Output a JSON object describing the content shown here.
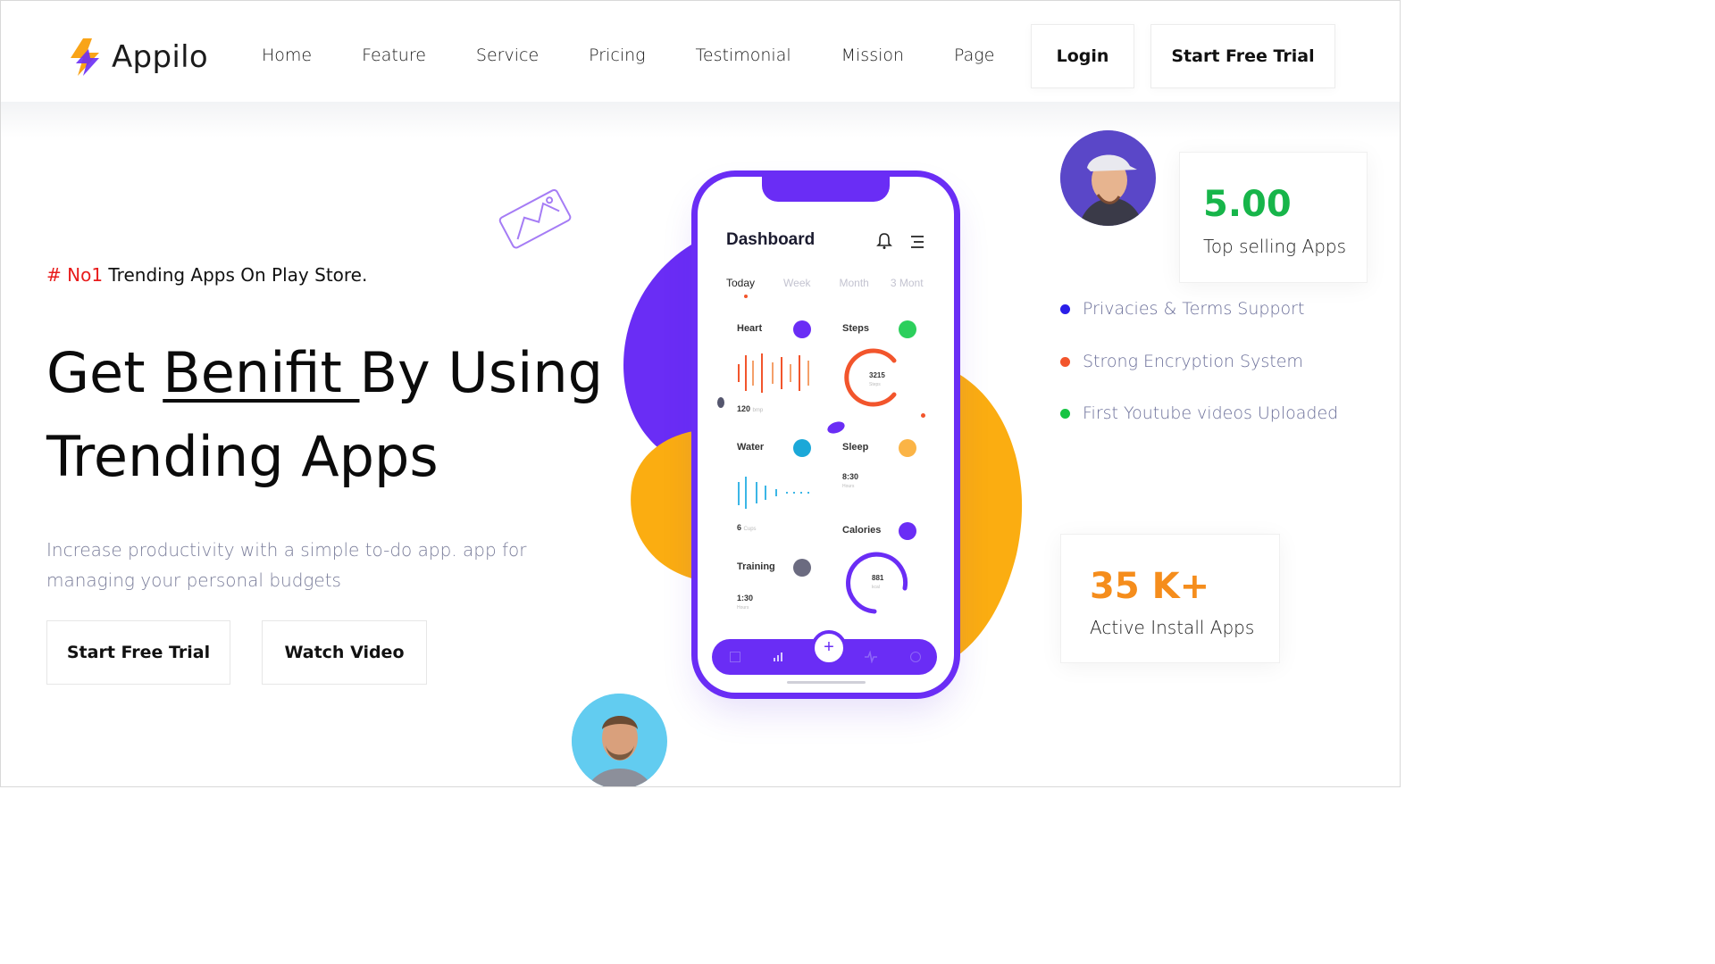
{
  "brand": {
    "name": "Appilo"
  },
  "nav": {
    "items": [
      "Home",
      "Feature",
      "Service",
      "Pricing",
      "Testimonial",
      "Mission",
      "Page"
    ]
  },
  "header": {
    "login_label": "Login",
    "trial_label": "Start Free Trial"
  },
  "hero": {
    "tag_highlight": "# No1",
    "tag_rest": "Trending Apps On Play Store.",
    "headline_pre": "Get ",
    "headline_underlined": "Benifit ",
    "headline_post": "By Using",
    "headline_line2": "Trending Apps",
    "description": "Increase productivity with a simple to-do app. app for managing your personal budgets",
    "cta_primary": "Start Free Trial",
    "cta_secondary": "Watch Video"
  },
  "stats": {
    "rating_value": "5.00",
    "rating_label": "Top selling Apps",
    "installs_value": "35 K+",
    "installs_label": "Active Install Apps"
  },
  "features": [
    {
      "label": "Privacies & Terms Support",
      "color": "#2a1ee8"
    },
    {
      "label": "Strong Encryption System",
      "color": "#f2552c"
    },
    {
      "label": "First Youtube videos Uploaded",
      "color": "#16c443"
    }
  ],
  "phone": {
    "title": "Dashboard",
    "tabs": [
      "Today",
      "Week",
      "Month",
      "3 Mont"
    ],
    "heart_label": "Heart",
    "heart_value": "120",
    "heart_unit": "bmp",
    "steps_label": "Steps",
    "steps_value": "3215",
    "steps_unit": "Steps",
    "water_label": "Water",
    "water_value": "6",
    "water_unit": "Cups",
    "sleep_label": "Sleep",
    "sleep_value": "8:30",
    "sleep_unit": "Hours",
    "calories_label": "Calories",
    "calories_value": "881",
    "calories_unit": "kcal",
    "training_label": "Training",
    "training_value": "1:30",
    "training_unit": "Hours"
  },
  "colors": {
    "purple": "#6a2df5",
    "orange": "#fbad11",
    "green": "#17b54a",
    "orange_text": "#f58d1c"
  }
}
